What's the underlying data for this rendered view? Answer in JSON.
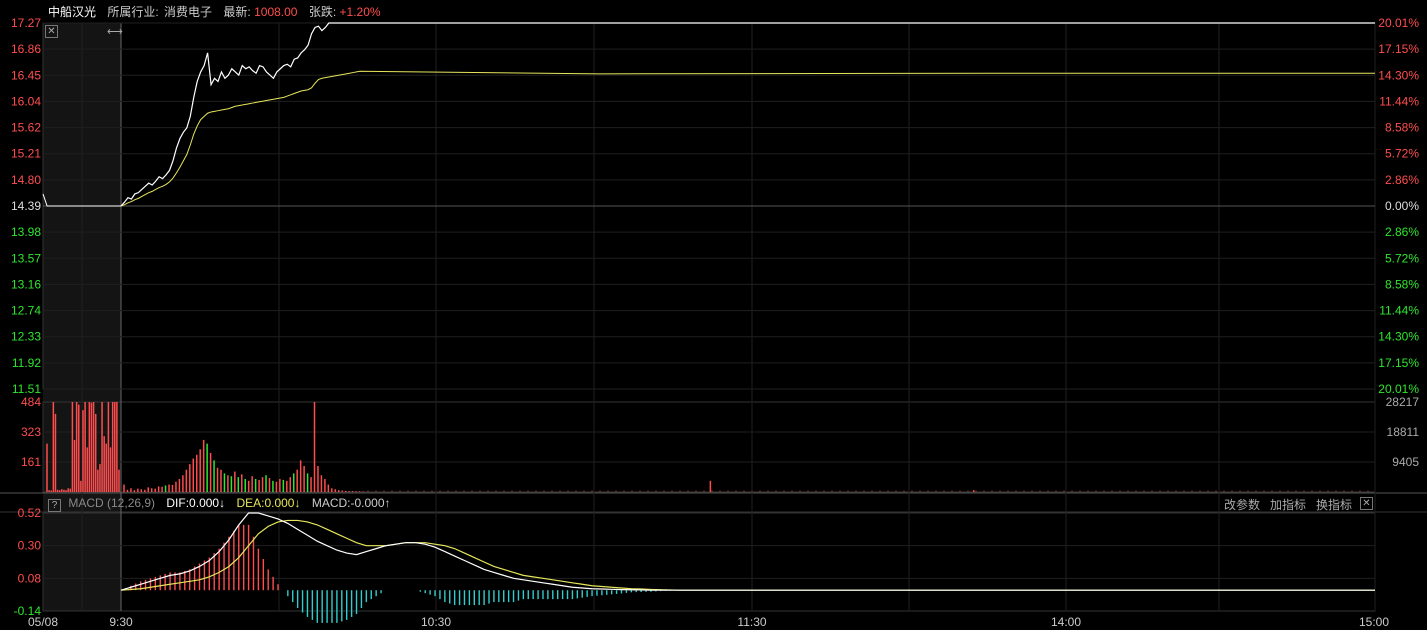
{
  "header": {
    "stock_name": "中船汉光",
    "industry_label": "所属行业:",
    "industry": "消费电子",
    "latest_label": "最新:",
    "latest_value": "1008.00",
    "change_label": "张跌:",
    "change_value": "+1.20%"
  },
  "macd_header": {
    "help": "?",
    "title": "MACD (12,26,9)",
    "dif": "DIF:0.000↓",
    "dea": "DEA:0.000↓",
    "macd": "MACD:-0.000↑",
    "buttons": [
      "改参数",
      "加指标",
      "换指标"
    ],
    "close": "✕"
  },
  "colors": {
    "up": "#ff4d4d",
    "down": "#2ee62e",
    "price_line": "#ffffff",
    "avg_line": "#e6e65c",
    "macd_neg": "#33cccc",
    "grid": "#1f1f1f"
  },
  "chart_data": [
    {
      "type": "line",
      "title": "",
      "x_ticks": [
        "05/08",
        "9:30",
        "10:30",
        "11:30",
        "14:00",
        "15:00"
      ],
      "y_ticks_left": [
        "17.27",
        "16.86",
        "16.45",
        "16.04",
        "15.62",
        "15.21",
        "14.80",
        "14.39",
        "13.98",
        "13.57",
        "13.16",
        "12.74",
        "12.33",
        "11.92",
        "11.51"
      ],
      "y_ticks_right": [
        "20.01%",
        "17.15%",
        "14.30%",
        "11.44%",
        "8.58%",
        "5.72%",
        "2.86%",
        "0.00%",
        "2.86%",
        "5.72%",
        "8.58%",
        "11.44%",
        "14.30%",
        "17.15%",
        "20.01%"
      ],
      "ylim": [
        11.51,
        17.27
      ],
      "prev_close": 14.39,
      "series": [
        {
          "values_prev_day": [
            14.58,
            14.39,
            14.39,
            14.39,
            14.39,
            14.39,
            14.39,
            14.39,
            14.39,
            14.39,
            14.39,
            14.39,
            14.39,
            14.39,
            14.39,
            14.39,
            14.39,
            14.39,
            14.39,
            14.39
          ],
          "values": [
            14.39,
            14.45,
            14.52,
            14.5,
            14.58,
            14.6,
            14.65,
            14.7,
            14.75,
            14.72,
            14.78,
            14.85,
            14.82,
            14.88,
            14.95,
            15.1,
            15.3,
            15.45,
            15.55,
            15.62,
            15.8,
            16.1,
            16.35,
            16.5,
            16.6,
            16.8,
            16.3,
            16.4,
            16.35,
            16.5,
            16.4,
            16.45,
            16.55,
            16.5,
            16.45,
            16.6,
            16.55,
            16.58,
            16.52,
            16.48,
            16.6,
            16.58,
            16.5,
            16.45,
            16.4,
            16.5,
            16.55,
            16.6,
            16.62,
            16.58,
            16.7,
            16.72,
            16.8,
            16.85,
            16.92,
            17.1,
            17.2,
            17.22,
            17.15,
            17.2,
            17.27,
            17.27,
            17.27,
            17.27,
            17.27,
            17.27,
            17.27,
            17.27,
            17.27,
            17.27
          ]
        },
        {
          "values": [
            14.39,
            14.41,
            14.44,
            14.46,
            14.49,
            14.51,
            14.54,
            14.57,
            14.6,
            14.62,
            14.65,
            14.68,
            14.7,
            14.73,
            14.77,
            14.83,
            14.91,
            15.0,
            15.1,
            15.2,
            15.35,
            15.52,
            15.65,
            15.75,
            15.8,
            15.85,
            15.87,
            15.88,
            15.89,
            15.9,
            15.91,
            15.92,
            15.94,
            15.96,
            15.97,
            15.98,
            15.99,
            16.0,
            16.01,
            16.02,
            16.03,
            16.04,
            16.05,
            16.06,
            16.07,
            16.08,
            16.09,
            16.1,
            16.12,
            16.14,
            16.16,
            16.18,
            16.2,
            16.21,
            16.22,
            16.25,
            16.32,
            16.38,
            16.4,
            16.41,
            16.42,
            16.43,
            16.44,
            16.45,
            16.46,
            16.47,
            16.48,
            16.49,
            16.5,
            16.51
          ]
        }
      ]
    },
    {
      "type": "bar",
      "title": "",
      "y_ticks_left": [
        "484",
        "323",
        "161"
      ],
      "y_ticks_right": [
        "28217",
        "18811",
        "9405"
      ],
      "ylim": [
        0,
        484
      ],
      "values_prev_day": [
        260,
        10,
        8,
        484,
        420,
        12,
        10,
        15,
        12,
        10,
        20,
        18,
        484,
        280,
        484,
        470,
        60,
        440,
        484,
        240,
        484,
        480,
        484,
        420,
        120,
        150,
        484,
        300,
        260,
        484,
        240,
        484,
        484,
        484,
        120
      ],
      "values": [
        40,
        12,
        20,
        10,
        18,
        15,
        12,
        25,
        20,
        18,
        30,
        28,
        35,
        40,
        38,
        55,
        70,
        90,
        120,
        150,
        180,
        200,
        230,
        280,
        260,
        210,
        170,
        130,
        120,
        100,
        90,
        85,
        110,
        80,
        95,
        70,
        60,
        85,
        70,
        65,
        80,
        90,
        75,
        60,
        55,
        70,
        65,
        60,
        80,
        100,
        120,
        170,
        140,
        100,
        80,
        484,
        140,
        90,
        70,
        40,
        20,
        15,
        10,
        8,
        6,
        5,
        5,
        4,
        4,
        3
      ],
      "up_down": [
        1,
        1,
        1,
        1,
        1,
        1,
        1,
        1,
        1,
        1,
        1,
        1,
        0,
        1,
        1,
        1,
        1,
        1,
        1,
        1,
        1,
        1,
        1,
        1,
        0,
        1,
        0,
        1,
        1,
        0,
        1,
        0,
        1,
        0,
        1,
        0,
        1,
        1,
        0,
        1,
        1,
        0,
        1,
        0,
        1,
        1,
        0,
        1,
        1,
        0,
        1,
        1,
        1,
        0,
        1,
        1,
        1,
        1,
        1,
        1,
        1,
        1,
        1,
        1,
        1,
        1,
        1,
        1,
        1,
        1
      ],
      "tail_spikes": [
        [
          0.47,
          60
        ],
        [
          0.68,
          10
        ]
      ]
    },
    {
      "type": "line",
      "title": "MACD (12,26,9)",
      "y_ticks_left": [
        "0.52",
        "0.30",
        "0.08",
        "-0.14"
      ],
      "ylim": [
        -0.14,
        0.52
      ],
      "series": [
        {
          "name": "DIF",
          "values": [
            0.0,
            0.02,
            0.04,
            0.06,
            0.08,
            0.1,
            0.11,
            0.13,
            0.16,
            0.2,
            0.26,
            0.34,
            0.44,
            0.52,
            0.52,
            0.5,
            0.48,
            0.45,
            0.41,
            0.37,
            0.33,
            0.3,
            0.27,
            0.25,
            0.24,
            0.26,
            0.28,
            0.3,
            0.31,
            0.32,
            0.32,
            0.31,
            0.29,
            0.26,
            0.23,
            0.2,
            0.17,
            0.14,
            0.12,
            0.1,
            0.08,
            0.07,
            0.06,
            0.05,
            0.04,
            0.03,
            0.02,
            0.015,
            0.01,
            0.008,
            0.006,
            0.004,
            0.003,
            0.002,
            0.0,
            0.0,
            0.0,
            0.0,
            0.0,
            0.0
          ]
        },
        {
          "name": "DEA",
          "values": [
            0.0,
            0.005,
            0.01,
            0.02,
            0.03,
            0.04,
            0.05,
            0.06,
            0.07,
            0.09,
            0.12,
            0.16,
            0.22,
            0.3,
            0.38,
            0.43,
            0.46,
            0.47,
            0.47,
            0.46,
            0.44,
            0.41,
            0.38,
            0.35,
            0.32,
            0.3,
            0.3,
            0.3,
            0.31,
            0.32,
            0.32,
            0.32,
            0.31,
            0.3,
            0.28,
            0.25,
            0.22,
            0.19,
            0.16,
            0.14,
            0.12,
            0.1,
            0.09,
            0.08,
            0.07,
            0.06,
            0.05,
            0.04,
            0.03,
            0.025,
            0.02,
            0.015,
            0.01,
            0.008,
            0.005,
            0.003,
            0.002,
            0.0,
            0.0,
            0.0
          ]
        }
      ]
    }
  ]
}
